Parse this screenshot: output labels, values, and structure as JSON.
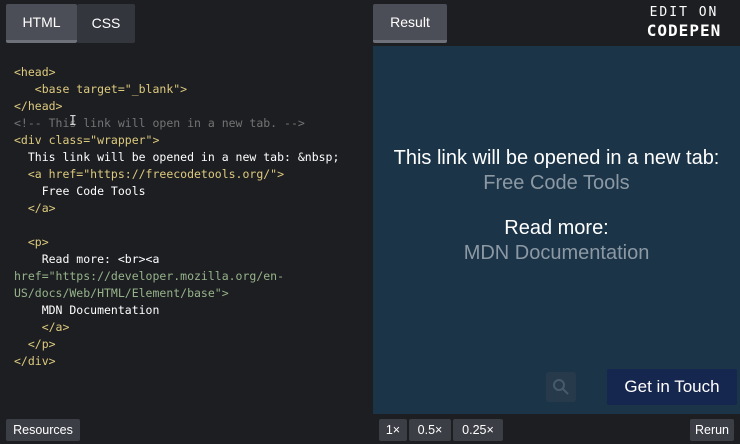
{
  "tabs": {
    "html": "HTML",
    "css": "CSS",
    "result": "Result"
  },
  "brand": {
    "line1": "EDIT ON",
    "line2": "CODEPEN"
  },
  "code_lines": [
    "<head>",
    "   <base target=\"_blank\">",
    "</head>",
    "<!-- This link will open in a new tab. -->",
    "<div class=\"wrapper\">",
    "  This link will be opened in a new tab: &nbsp;",
    "  <a href=\"https://freecodetools.org/\">",
    "    Free Code Tools",
    "  </a>",
    "",
    "  <p>",
    "    Read more: <br><a",
    "href=\"https://developer.mozilla.org/en-",
    "US/docs/Web/HTML/Element/base\">",
    "    MDN Documentation",
    "    </a>",
    "  </p>",
    "</div>"
  ],
  "result": {
    "text1": "This link will be opened in a new tab:",
    "link1": "Free Code Tools",
    "text2": "Read more:",
    "link2": "MDN Documentation",
    "cta": "Get in Touch"
  },
  "bottom": {
    "resources": "Resources",
    "zoom_1x": "1×",
    "zoom_05x": "0.5×",
    "zoom_025x": "0.25×",
    "rerun": "Rerun"
  },
  "colors": {
    "result_bg": "#1b3448",
    "editor_bg": "#1d1e22",
    "cta_bg": "#15264f"
  },
  "icons": {
    "search": "search-icon"
  }
}
